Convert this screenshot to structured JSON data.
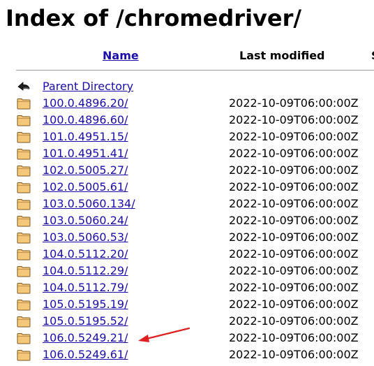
{
  "page": {
    "title": "Index of /chromedriver/"
  },
  "columns": {
    "name": "Name",
    "last_modified": "Last modified",
    "size": "S"
  },
  "parent": {
    "label": "Parent Directory",
    "icon": "back-arrow-icon"
  },
  "entries": [
    {
      "name": "100.0.4896.20/",
      "modified": "2022-10-09T06:00:00Z",
      "icon": "folder-icon"
    },
    {
      "name": "100.0.4896.60/",
      "modified": "2022-10-09T06:00:00Z",
      "icon": "folder-icon"
    },
    {
      "name": "101.0.4951.15/",
      "modified": "2022-10-09T06:00:00Z",
      "icon": "folder-icon"
    },
    {
      "name": "101.0.4951.41/",
      "modified": "2022-10-09T06:00:00Z",
      "icon": "folder-icon"
    },
    {
      "name": "102.0.5005.27/",
      "modified": "2022-10-09T06:00:00Z",
      "icon": "folder-icon"
    },
    {
      "name": "102.0.5005.61/",
      "modified": "2022-10-09T06:00:00Z",
      "icon": "folder-icon"
    },
    {
      "name": "103.0.5060.134/",
      "modified": "2022-10-09T06:00:00Z",
      "icon": "folder-icon"
    },
    {
      "name": "103.0.5060.24/",
      "modified": "2022-10-09T06:00:00Z",
      "icon": "folder-icon"
    },
    {
      "name": "103.0.5060.53/",
      "modified": "2022-10-09T06:00:00Z",
      "icon": "folder-icon"
    },
    {
      "name": "104.0.5112.20/",
      "modified": "2022-10-09T06:00:00Z",
      "icon": "folder-icon"
    },
    {
      "name": "104.0.5112.29/",
      "modified": "2022-10-09T06:00:00Z",
      "icon": "folder-icon"
    },
    {
      "name": "104.0.5112.79/",
      "modified": "2022-10-09T06:00:00Z",
      "icon": "folder-icon"
    },
    {
      "name": "105.0.5195.19/",
      "modified": "2022-10-09T06:00:00Z",
      "icon": "folder-icon"
    },
    {
      "name": "105.0.5195.52/",
      "modified": "2022-10-09T06:00:00Z",
      "icon": "folder-icon"
    },
    {
      "name": "106.0.5249.21/",
      "modified": "2022-10-09T06:00:00Z",
      "icon": "folder-icon"
    },
    {
      "name": "106.0.5249.61/",
      "modified": "2022-10-09T06:00:00Z",
      "icon": "folder-icon"
    }
  ],
  "annotation": {
    "icon": "red-pointer-arrow-icon",
    "color": "#e02020"
  },
  "colors": {
    "link": "#1a0dab",
    "folder_fill": "#f4c77a",
    "folder_stroke": "#7a5a1e"
  }
}
